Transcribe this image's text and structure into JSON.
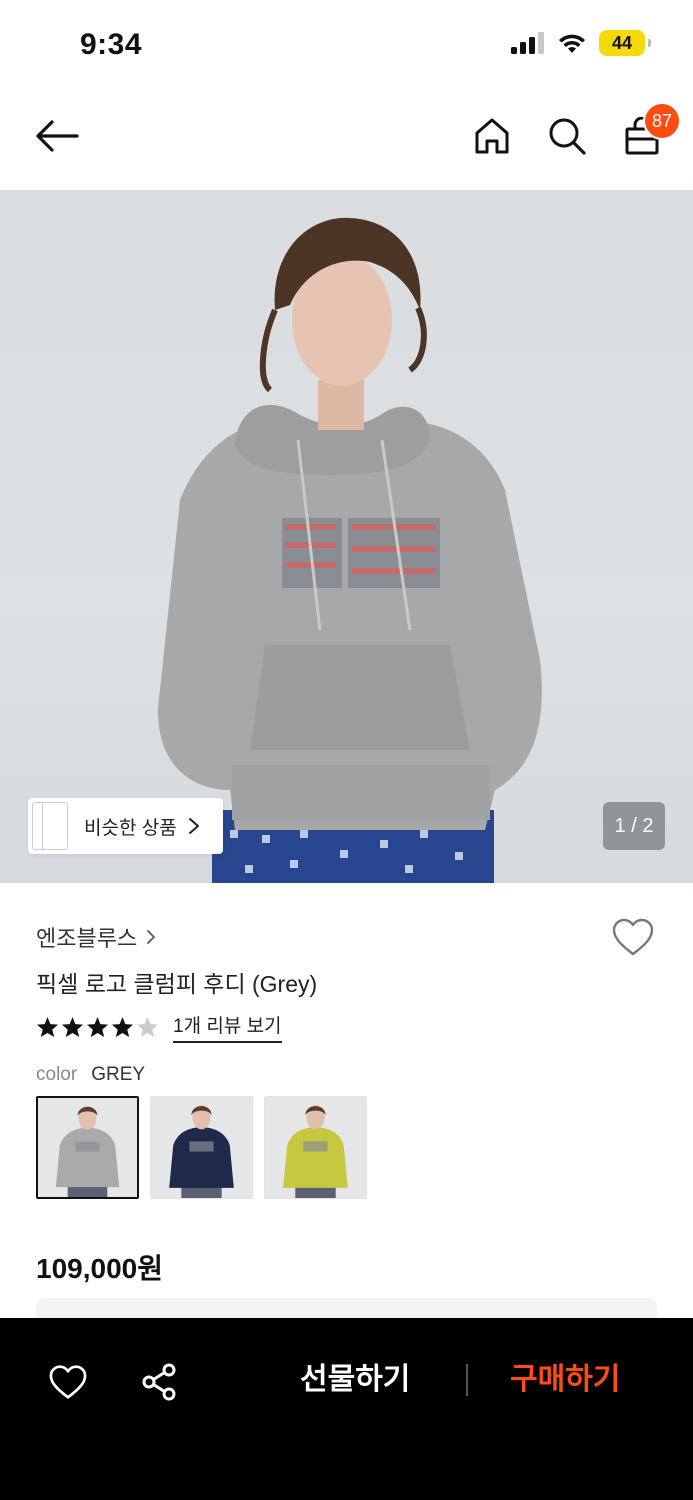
{
  "status_bar": {
    "time": "9:34",
    "battery": "44"
  },
  "header": {
    "cart_count": "87"
  },
  "gallery": {
    "similar_label": "비슷한 상품",
    "page_indicator": "1 / 2"
  },
  "product": {
    "brand": "엔조블루스",
    "name": "픽셀 로고 클럼피 후디 (Grey)",
    "rating_stars": 4,
    "rating_max": 5,
    "review_link": "1개 리뷰 보기",
    "color_label": "color",
    "color_value": "GREY",
    "swatches": [
      {
        "color": "grey",
        "hex": "#a9aaab",
        "selected": true
      },
      {
        "color": "navy",
        "hex": "#1f2a4a",
        "selected": false
      },
      {
        "color": "lime",
        "hex": "#c6c83f",
        "selected": false
      }
    ],
    "price": "109,000원"
  },
  "bottom_bar": {
    "gift_label": "선물하기",
    "buy_label": "구매하기",
    "accent_color": "#ff4d12"
  },
  "icons": [
    "back-arrow-icon",
    "home-icon",
    "search-icon",
    "shopping-bag-icon",
    "heart-icon",
    "share-icon",
    "chevron-right-icon",
    "star-icon"
  ]
}
